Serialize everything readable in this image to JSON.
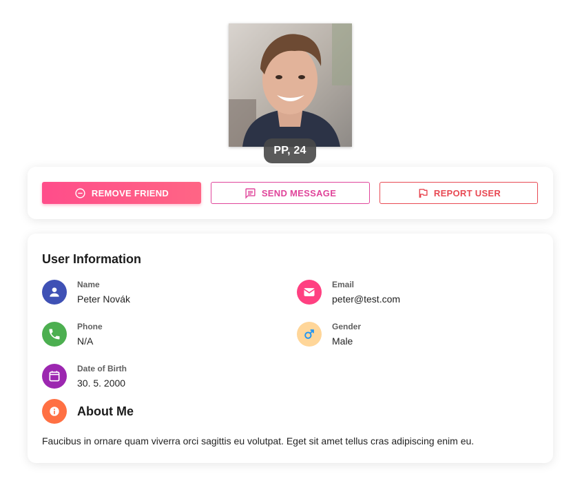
{
  "profile": {
    "badge": "PP, 24",
    "photo_alt": "Profile photo"
  },
  "actions": {
    "remove_friend": "REMOVE FRIEND",
    "send_message": "SEND MESSAGE",
    "report_user": "REPORT USER"
  },
  "user_info": {
    "title": "User Information",
    "name": {
      "label": "Name",
      "value": "Peter Novák",
      "icon": "person-icon",
      "color": "#3f51b5"
    },
    "email": {
      "label": "Email",
      "value": "peter@test.com",
      "icon": "mail-icon",
      "color": "#ff4081"
    },
    "phone": {
      "label": "Phone",
      "value": "N/A",
      "icon": "phone-icon",
      "color": "#4caf50"
    },
    "gender": {
      "label": "Gender",
      "value": "Male",
      "icon": "male-icon",
      "color": "#ffd699"
    },
    "dob": {
      "label": "Date of Birth",
      "value": "30. 5. 2000",
      "icon": "calendar-icon",
      "color": "#9c27b0"
    }
  },
  "about": {
    "title": "About Me",
    "text": "Faucibus in ornare quam viverra orci sagittis eu volutpat. Eget sit amet tellus cras adipiscing enim eu.",
    "icon": "info-icon",
    "color": "#ff7043"
  }
}
